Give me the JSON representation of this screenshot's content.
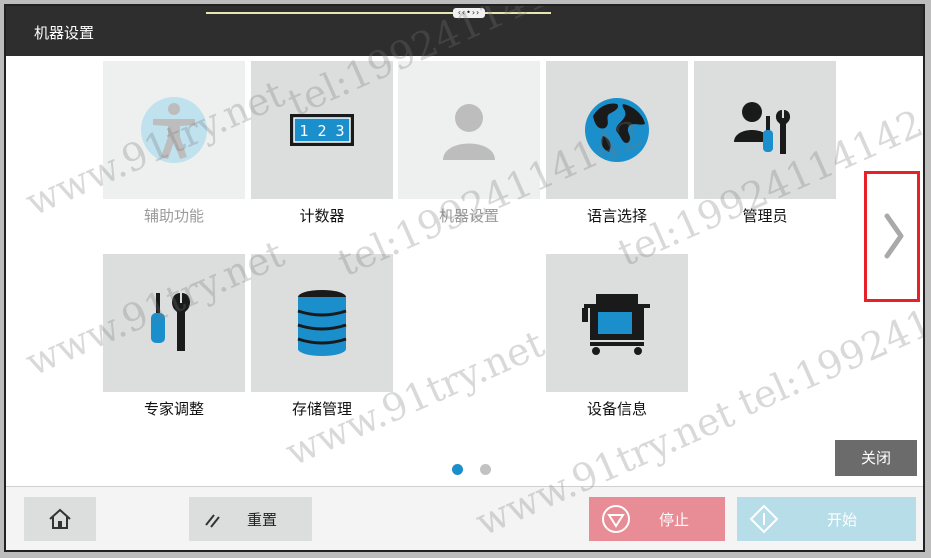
{
  "window": {
    "title": "机器设置",
    "handle": "‹‹•››"
  },
  "tiles": [
    {
      "label": "辅助功能",
      "disabled": true,
      "icon": "accessibility-icon"
    },
    {
      "label": "计数器",
      "disabled": false,
      "icon": "counter-icon",
      "counter_text": "1 2 3"
    },
    {
      "label": "机器设置",
      "disabled": true,
      "icon": "user-silhouette-icon"
    },
    {
      "label": "语言选择",
      "disabled": false,
      "icon": "globe-icon"
    },
    {
      "label": "管理员",
      "disabled": false,
      "icon": "admin-tools-icon"
    },
    {
      "label": "专家调整",
      "disabled": false,
      "icon": "expert-tools-icon"
    },
    {
      "label": "存储管理",
      "disabled": false,
      "icon": "storage-database-icon"
    },
    {
      "label": "设备信息",
      "disabled": false,
      "icon": "device-info-icon"
    }
  ],
  "pagination": {
    "current": 1,
    "total": 2
  },
  "buttons": {
    "close": "关闭",
    "reset": "重置",
    "stop": "停止",
    "start": "开始"
  },
  "watermarks": [
    "www.91try.net",
    "tel:19924114142"
  ],
  "colors": {
    "titlebar": "#2e2e2e",
    "accent_blue": "#1a8fcc",
    "highlight_red": "#e6212a",
    "stop": "#e88c95",
    "start": "#b7dde8"
  }
}
